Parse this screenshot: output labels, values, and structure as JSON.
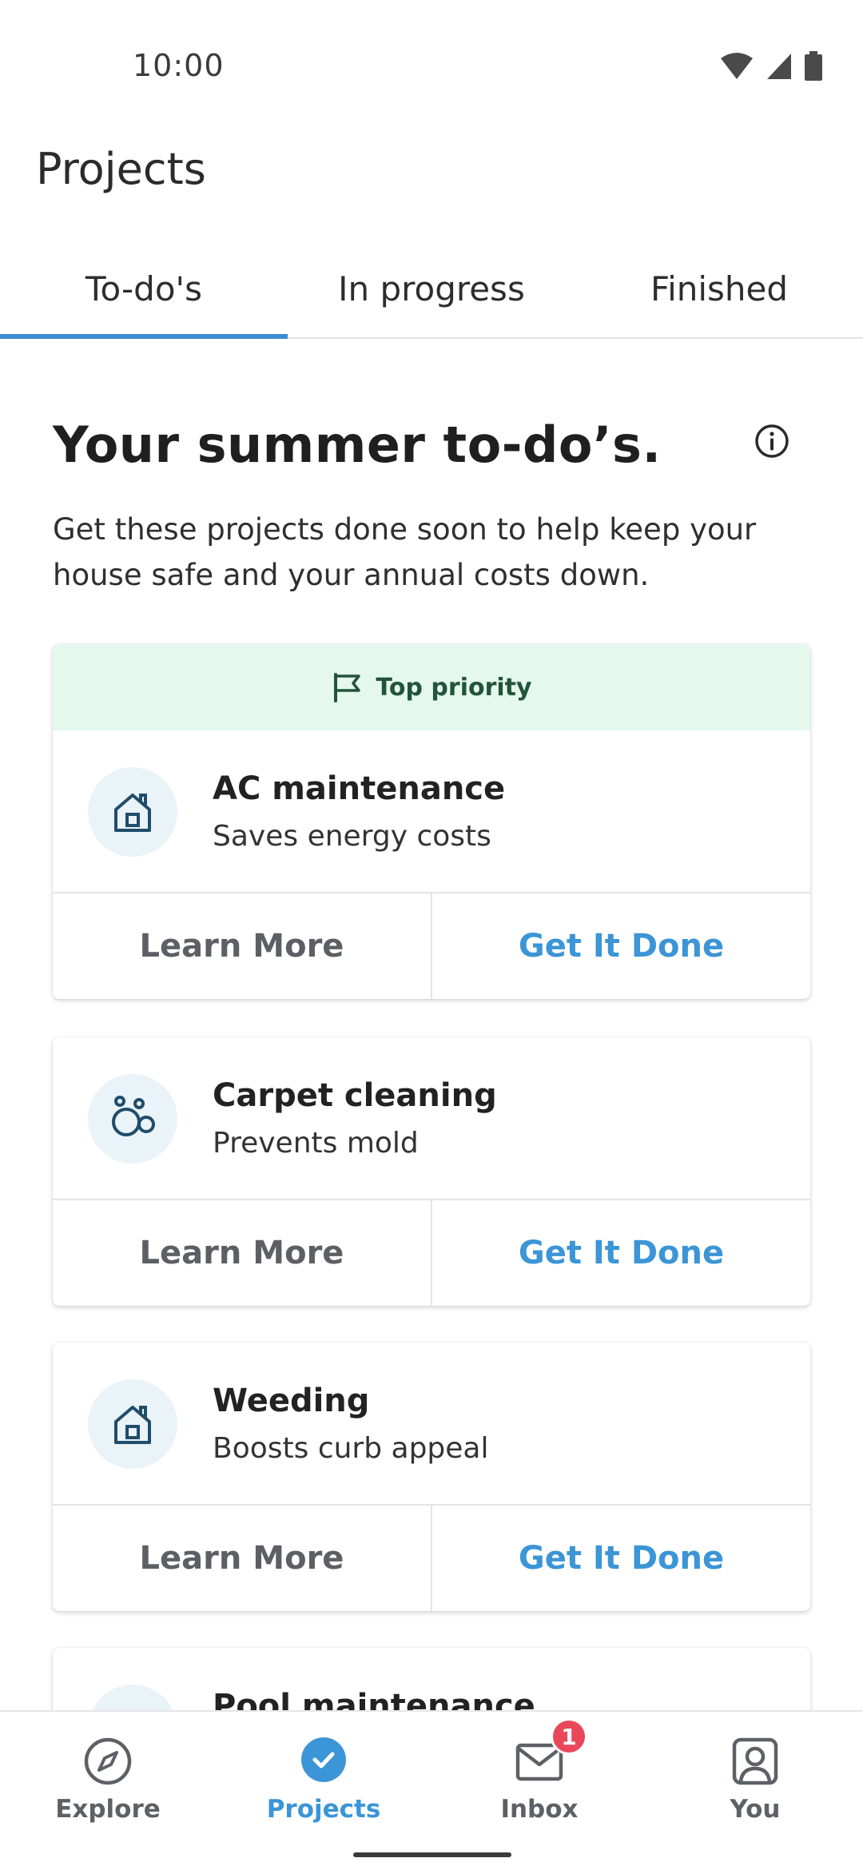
{
  "status_bar": {
    "time": "10:00"
  },
  "header": {
    "title": "Projects"
  },
  "tabs": [
    {
      "label": "To-do's",
      "active": true
    },
    {
      "label": "In progress",
      "active": false
    },
    {
      "label": "Finished",
      "active": false
    }
  ],
  "main": {
    "headline": "Your summer to-do’s.",
    "subtext": "Get these projects done soon to help keep your house safe and your annual costs down.",
    "priority_label": "Top priority",
    "cards": [
      {
        "title": "AC maintenance",
        "subtitle": "Saves energy costs",
        "icon": "house-icon",
        "learn_label": "Learn More",
        "done_label": "Get It Done"
      },
      {
        "title": "Carpet cleaning",
        "subtitle": "Prevents mold",
        "icon": "bubbles-icon",
        "learn_label": "Learn More",
        "done_label": "Get It Done"
      },
      {
        "title": "Weeding",
        "subtitle": "Boosts curb appeal",
        "icon": "house-icon",
        "learn_label": "Learn More",
        "done_label": "Get It Done"
      },
      {
        "title": "Pool maintenance",
        "icon": "house-icon"
      }
    ]
  },
  "bottom_nav": {
    "items": [
      {
        "label": "Explore",
        "icon": "compass-icon"
      },
      {
        "label": "Projects",
        "icon": "check-circle-icon",
        "active": true
      },
      {
        "label": "Inbox",
        "icon": "mail-icon",
        "badge": "1"
      },
      {
        "label": "You",
        "icon": "person-icon"
      }
    ]
  },
  "colors": {
    "accent": "#3b95d6",
    "tab_indicator": "#3b8bd0",
    "priority_bg": "#e4f8ee",
    "priority_text": "#23533a",
    "badge": "#e9475a"
  }
}
